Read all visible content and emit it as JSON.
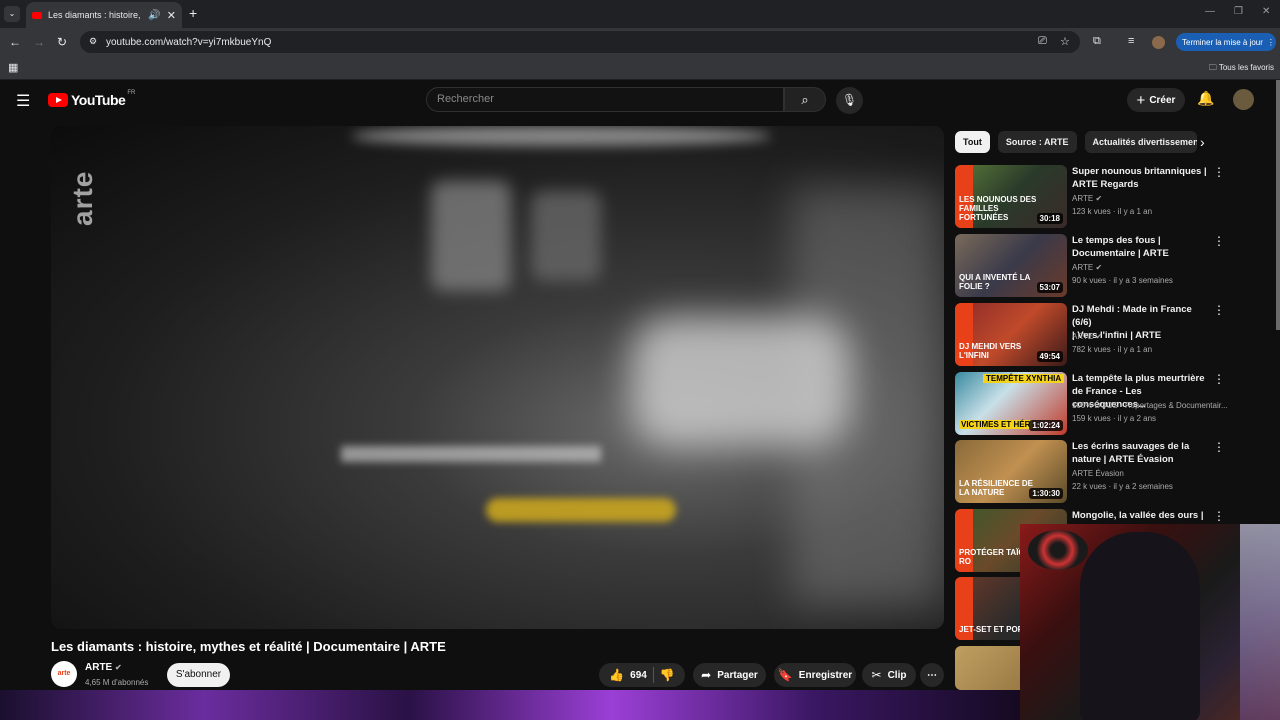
{
  "browser": {
    "tab_title": "Les diamants : histoire, myth",
    "url": "youtube.com/watch?v=yi7mkbueYnQ",
    "update_button": "Terminer la mise à jour",
    "bookmarks_all": "Tous les favoris"
  },
  "header": {
    "logo_text": "YouTube",
    "country": "FR",
    "search_placeholder": "Rechercher",
    "create_label": "Créer"
  },
  "video": {
    "watermark": "arte",
    "title": "Les diamants : histoire, mythes et réalité | Documentaire | ARTE",
    "channel_logo": "arte",
    "channel_name": "ARTE",
    "subscribers": "4,65 M d'abonnés",
    "subscribe_label": "S'abonner",
    "likes": "694",
    "share_label": "Partager",
    "save_label": "Enregistrer",
    "clip_label": "Clip"
  },
  "chips": [
    "Tout",
    "Source : ARTE",
    "Actualités divertissemen"
  ],
  "recommendations": [
    {
      "title_line1": "Super nounous britanniques |",
      "title_line2": "ARTE Regards",
      "channel": "ARTE",
      "meta": "123 k vues · il y a 1 an",
      "duration": "30:18",
      "thumb_text": "LES NOUNOUS DES FAMILLES FORTUNÉES"
    },
    {
      "title_line1": "Le temps des fous |",
      "title_line2": "Documentaire | ARTE",
      "channel": "ARTE",
      "meta": "90 k vues · il y a 3 semaines",
      "duration": "53:07",
      "thumb_text": "QUI A INVENTÉ LA FOLIE ?"
    },
    {
      "title_line1": "DJ Mehdi : Made in France (6/6)",
      "title_line2": "| Vers l'infini | ARTE",
      "channel": "ARTE",
      "meta": "782 k vues · il y a 1 an",
      "duration": "49:54",
      "thumb_text": "DJ MEHDI VERS L'INFINI"
    },
    {
      "title_line1": "La tempête la plus meurtrière",
      "title_line2": "de France - Les conséquences...",
      "channel": "100% DOCS - Reportages & Documentair...",
      "meta": "159 k vues · il y a 2 ans",
      "duration": "1:02:24",
      "thumb_text": "VICTIMES ET HÉR",
      "thumb_top": "TEMPÊTE XYNTHIA"
    },
    {
      "title_line1": "Les écrins sauvages de la",
      "title_line2": "nature | ARTE Évasion",
      "channel": "ARTE Évasion",
      "meta": "22 k vues · il y a 2 semaines",
      "duration": "1:30:30",
      "thumb_text": "LA RÉSILIENCE DE LA NATURE"
    },
    {
      "title_line1": "Mongolie, la vallée des ours |",
      "title_line2": "",
      "channel": "",
      "meta": "",
      "duration": "",
      "thumb_text": "PROTÉGER TAÏGA RO"
    },
    {
      "title_line1": "",
      "title_line2": "",
      "channel": "",
      "meta": "",
      "duration": "",
      "thumb_text": "JET-SET ET PORNO"
    }
  ],
  "colors": {
    "youtube_red": "#ff0000",
    "arte_orange": "#e8411a",
    "bg": "#0f0f0f"
  }
}
